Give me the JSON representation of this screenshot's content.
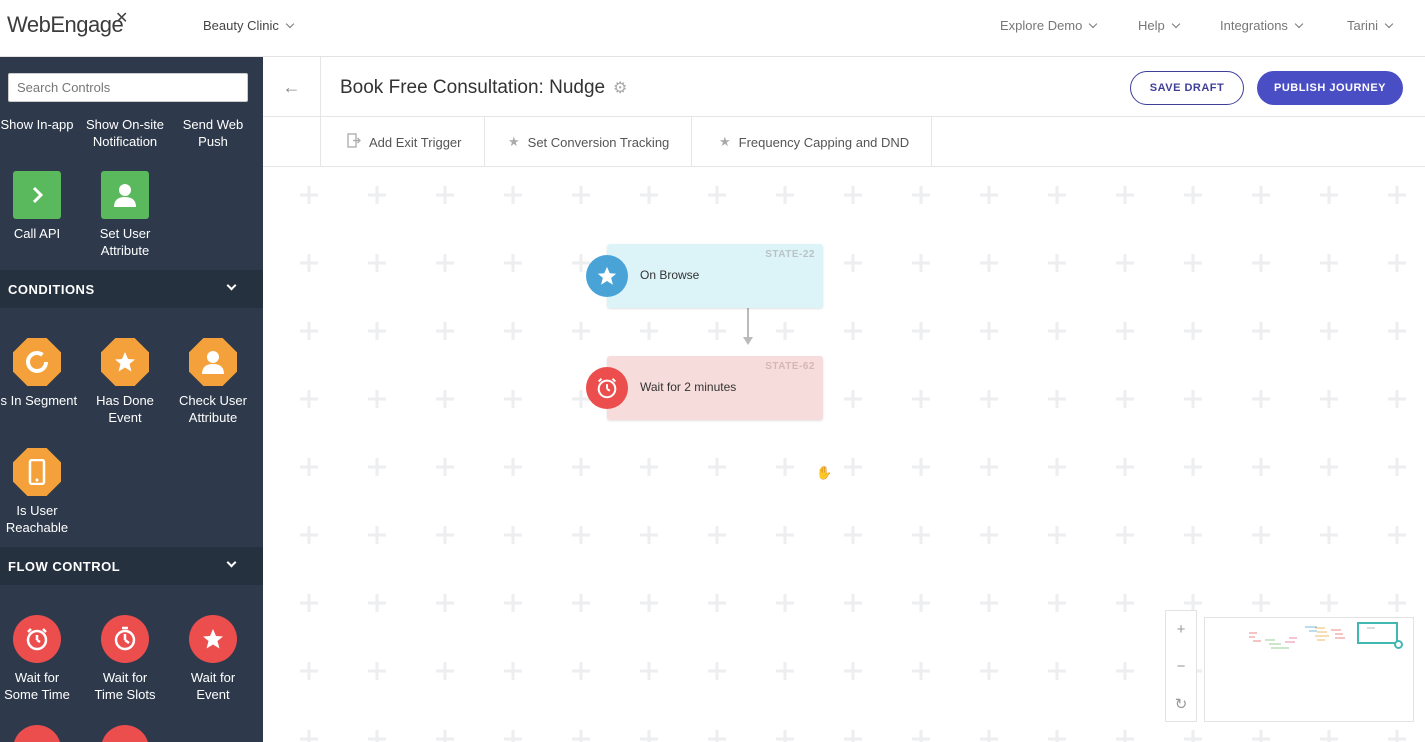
{
  "brand": {
    "logo_text": "WebEngage",
    "account_name": "Beauty Clinic"
  },
  "topnav": {
    "explore_demo": "Explore Demo",
    "help": "Help",
    "integrations": "Integrations",
    "user": "Tarini"
  },
  "sidebar": {
    "search_placeholder": "Search Controls",
    "partial_row": {
      "a": "Show In-app",
      "b_line1": "Show On-site",
      "b_line2": "Notification",
      "c_line1": "Send Web",
      "c_line2": "Push"
    },
    "actions": [
      {
        "line1": "Call API",
        "line2": ""
      },
      {
        "line1": "Set User",
        "line2": "Attribute"
      }
    ],
    "conditions_title": "CONDITIONS",
    "conditions": [
      {
        "line1": "Is In Segment",
        "line2": ""
      },
      {
        "line1": "Has Done",
        "line2": "Event"
      },
      {
        "line1": "Check User",
        "line2": "Attribute"
      },
      {
        "line1": "Is User",
        "line2": "Reachable"
      }
    ],
    "flow_title": "FLOW CONTROL",
    "flow": [
      {
        "line1": "Wait for",
        "line2": "Some Time"
      },
      {
        "line1": "Wait for",
        "line2": "Time Slots"
      },
      {
        "line1": "Wait for",
        "line2": "Event"
      }
    ]
  },
  "header": {
    "title": "Book Free Consultation: Nudge",
    "save_draft": "SAVE DRAFT",
    "publish": "PUBLISH JOURNEY"
  },
  "toolbar": {
    "exit_trigger": "Add Exit Trigger",
    "conversion": "Set Conversion Tracking",
    "capping": "Frequency Capping and DND"
  },
  "nodes": [
    {
      "state": "STATE-22",
      "label": "On Browse"
    },
    {
      "state": "STATE-62",
      "label": "Wait for 2 minutes"
    }
  ],
  "colors": {
    "sidebar_bg": "#2e3a4b",
    "action_green": "#59b95c",
    "condition_orange": "#f4a13b",
    "flow_red": "#ec4d4d",
    "primary": "#4a4ec4",
    "minimap_teal": "#41b9b0"
  }
}
